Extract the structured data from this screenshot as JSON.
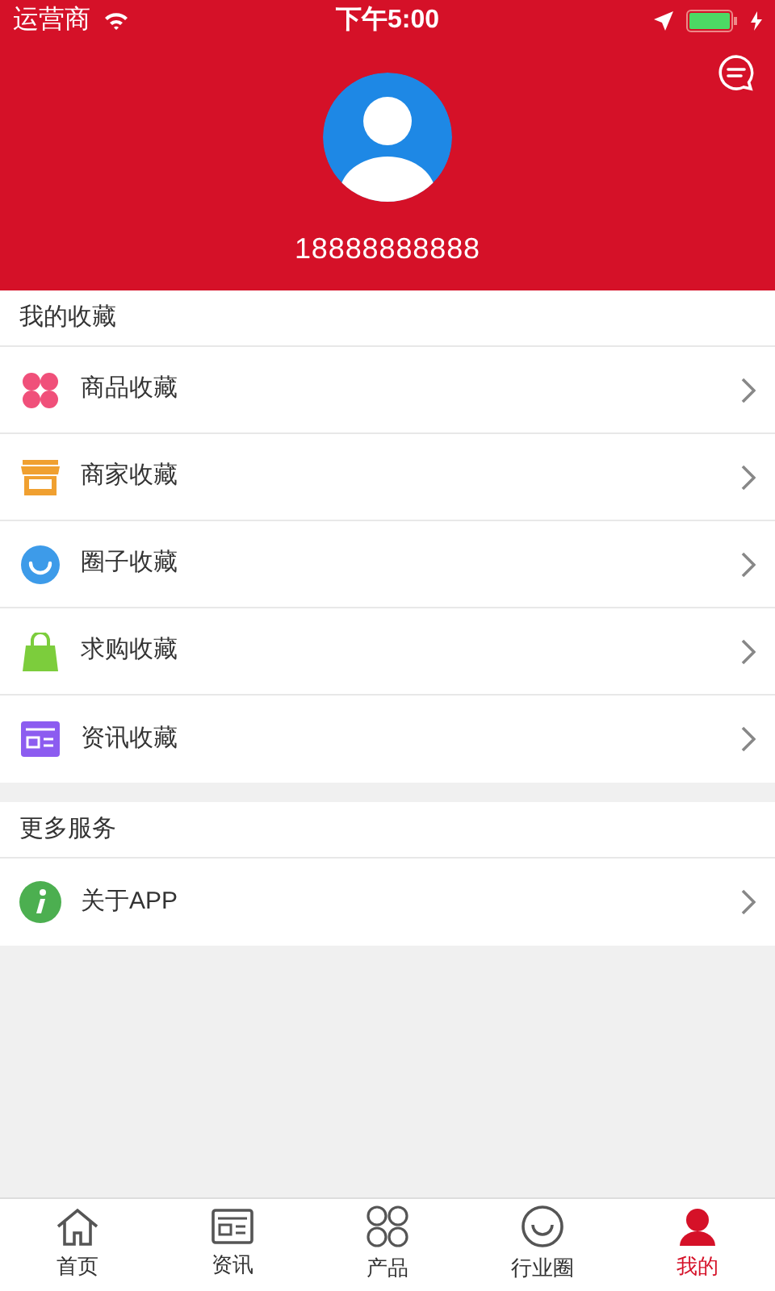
{
  "status_bar": {
    "carrier": "运营商",
    "time": "下午5:00"
  },
  "profile": {
    "phone": "18888888888"
  },
  "sections": [
    {
      "title": "我的收藏",
      "items": [
        {
          "kind": "goods",
          "label": "商品收藏"
        },
        {
          "kind": "shop",
          "label": "商家收藏"
        },
        {
          "kind": "circle",
          "label": "圈子收藏"
        },
        {
          "kind": "bag",
          "label": "求购收藏"
        },
        {
          "kind": "news",
          "label": "资讯收藏"
        }
      ]
    },
    {
      "title": "更多服务",
      "items": [
        {
          "kind": "info",
          "label": "关于APP"
        }
      ]
    }
  ],
  "tabs": [
    {
      "kind": "home",
      "label": "首页",
      "selected": false
    },
    {
      "kind": "news",
      "label": "资讯",
      "selected": false
    },
    {
      "kind": "products",
      "label": "产品",
      "selected": false
    },
    {
      "kind": "circle",
      "label": "行业圈",
      "selected": false
    },
    {
      "kind": "me",
      "label": "我的",
      "selected": true
    }
  ]
}
